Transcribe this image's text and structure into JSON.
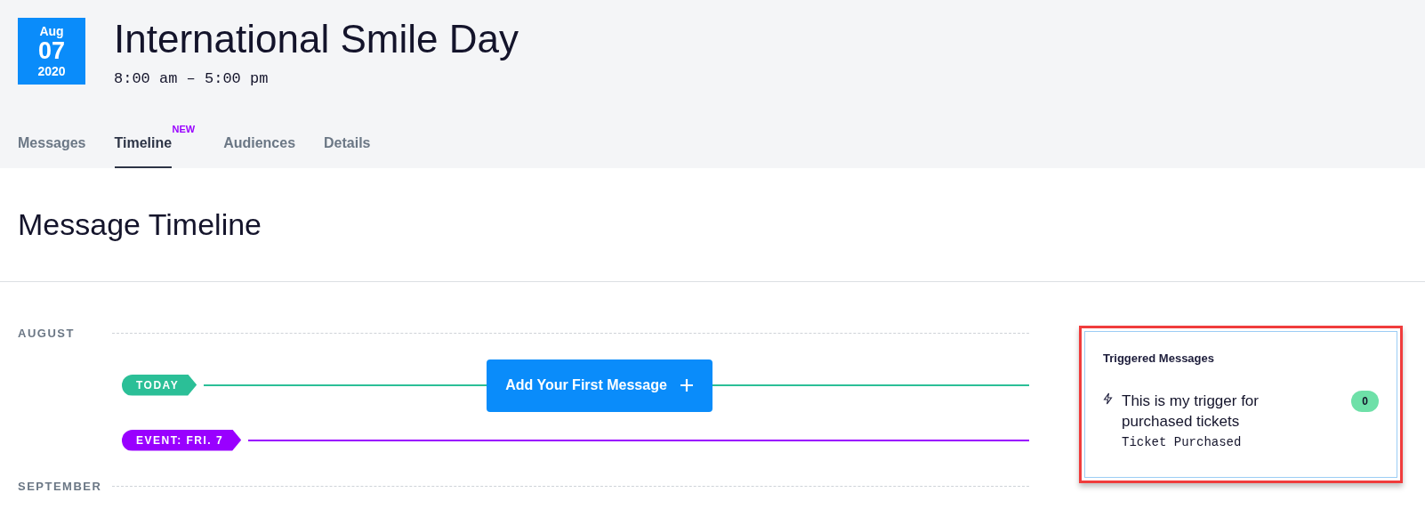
{
  "event": {
    "month": "Aug",
    "day": "07",
    "year": "2020",
    "title": "International Smile Day",
    "time": "8:00 am – 5:00 pm"
  },
  "tabs": [
    {
      "label": "Messages",
      "selected": false
    },
    {
      "label": "Timeline",
      "selected": true,
      "badge": "NEW"
    },
    {
      "label": "Audiences",
      "selected": false
    },
    {
      "label": "Details",
      "selected": false
    }
  ],
  "heading": "Message Timeline",
  "timeline": {
    "months": [
      "AUGUST",
      "SEPTEMBER"
    ],
    "markers": [
      {
        "label": "TODAY",
        "color": "#2bbf97"
      },
      {
        "label": "EVENT: FRI. 7",
        "color": "#9900ff"
      }
    ],
    "add_button": "Add Your First Message"
  },
  "triggered": {
    "title": "Triggered Messages",
    "items": [
      {
        "name": "This is my trigger for purchased tickets",
        "event": "Ticket Purchased",
        "count": "0"
      }
    ]
  }
}
